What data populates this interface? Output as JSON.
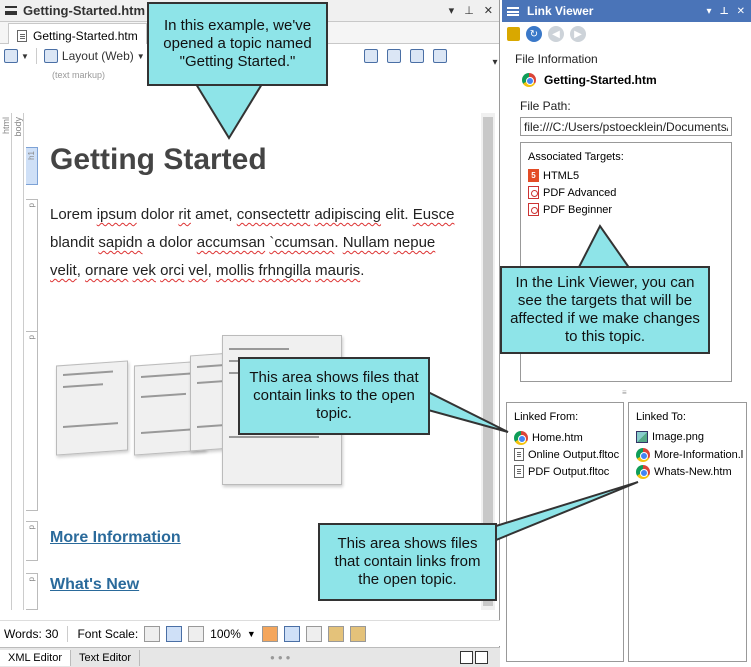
{
  "left_panel": {
    "title": "Getting-Started.htm",
    "doc_tab": "Getting-Started.htm",
    "toolbar": {
      "layout_label": "Layout (Web)",
      "hidden_label": "out"
    },
    "subtle_text": "(text markup)",
    "structure": {
      "html": "html",
      "body": "body",
      "h1": "h1",
      "p": "p"
    },
    "heading": "Getting Started",
    "paragraph": [
      {
        "t": "Lorem ",
        "e": false
      },
      {
        "t": "ipsum",
        "e": true
      },
      {
        "t": " dolor ",
        "e": false
      },
      {
        "t": "rit",
        "e": true
      },
      {
        "t": " amet, ",
        "e": false
      },
      {
        "t": "consectettr",
        "e": true
      },
      {
        "t": " ",
        "e": false
      },
      {
        "t": "adipiscing",
        "e": true
      },
      {
        "t": " elit. ",
        "e": false
      },
      {
        "t": "Eusce",
        "e": true
      },
      {
        "t": " blandit ",
        "e": false
      },
      {
        "t": "sapidn",
        "e": true
      },
      {
        "t": " a dolor ",
        "e": false
      },
      {
        "t": "accumsan",
        "e": true
      },
      {
        "t": " ",
        "e": false
      },
      {
        "t": "`ccumsan",
        "e": true
      },
      {
        "t": ". ",
        "e": false
      },
      {
        "t": "Nullam",
        "e": true
      },
      {
        "t": " ",
        "e": false
      },
      {
        "t": "nepue",
        "e": true
      },
      {
        "t": " ",
        "e": false
      },
      {
        "t": "velit",
        "e": true
      },
      {
        "t": ", ",
        "e": false
      },
      {
        "t": "ornare",
        "e": true
      },
      {
        "t": " ",
        "e": false
      },
      {
        "t": "vek",
        "e": true
      },
      {
        "t": " ",
        "e": false
      },
      {
        "t": "orci",
        "e": true
      },
      {
        "t": " ",
        "e": false
      },
      {
        "t": "vel",
        "e": true
      },
      {
        "t": ", ",
        "e": false
      },
      {
        "t": "mollis",
        "e": true
      },
      {
        "t": " ",
        "e": false
      },
      {
        "t": "frhngilla",
        "e": true
      },
      {
        "t": " ",
        "e": false
      },
      {
        "t": "mauris",
        "e": true
      },
      {
        "t": ".",
        "e": false
      }
    ],
    "link_more": "More Information",
    "link_new": "What's New",
    "status": {
      "words": "Words: 30",
      "font_scale_label": "Font Scale:",
      "zoom": "100%"
    },
    "editor_tabs": {
      "xml": "XML Editor",
      "text": "Text Editor"
    }
  },
  "right_panel": {
    "title": "Link Viewer",
    "file_info_label": "File Information",
    "file_name": "Getting-Started.htm",
    "file_path_label": "File Path:",
    "file_path": "file:///C:/Users/pstoecklein/Documents/My",
    "associated_targets_label": "Associated Targets:",
    "targets": [
      {
        "name": "HTML5",
        "icon": "html5-icon"
      },
      {
        "name": "PDF Advanced",
        "icon": "pdf-icon"
      },
      {
        "name": "PDF Beginner",
        "icon": "pdf-icon"
      }
    ],
    "linked_from_label": "Linked From:",
    "linked_from": [
      {
        "name": "Home.htm",
        "icon": "chrome-icon"
      },
      {
        "name": "Online Output.fltoc",
        "icon": "document-icon"
      },
      {
        "name": "PDF Output.fltoc",
        "icon": "document-icon"
      }
    ],
    "linked_to_label": "Linked To:",
    "linked_to": [
      {
        "name": "Image.png",
        "icon": "image-icon"
      },
      {
        "name": "More-Information.l",
        "icon": "chrome-icon"
      },
      {
        "name": "Whats-New.htm",
        "icon": "chrome-icon"
      }
    ]
  },
  "callouts": {
    "example": "In this example, we've opened a topic named \"Getting Started.\"",
    "link_viewer": "In the Link Viewer, you can see the targets that will be affected if we make changes to this topic.",
    "links_to": "This area shows files that contain links to the open topic.",
    "links_from": "This area shows files that contain links from the open topic."
  },
  "colors": {
    "callout_bg": "#8ee4e8",
    "title_blue": "#4a74b8",
    "link": "#2a6a9b"
  }
}
